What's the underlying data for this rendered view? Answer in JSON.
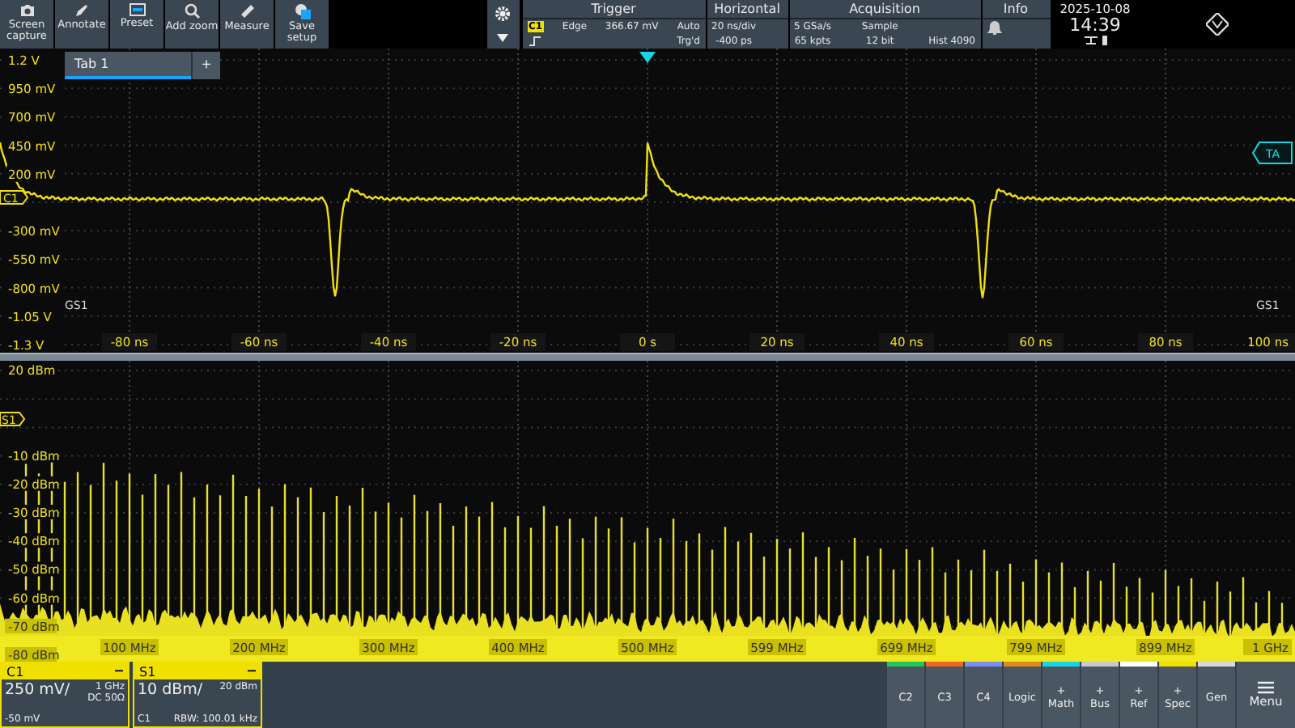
{
  "toolbar": {
    "buttons": [
      {
        "label": "Screen capture"
      },
      {
        "label": "Annotate"
      },
      {
        "label": "Preset"
      },
      {
        "label": "Add zoom"
      },
      {
        "label": "Measure"
      },
      {
        "label": "Save setup"
      }
    ]
  },
  "trigger": {
    "title": "Trigger",
    "source": "C1",
    "type": "Edge",
    "level": "366.67 mV",
    "mode": "Auto",
    "state": "Trg'd"
  },
  "horizontal": {
    "title": "Horizontal",
    "scale": "20 ns/div",
    "position": "-400 ps"
  },
  "acquisition": {
    "title": "Acquisition",
    "sample_rate": "5 GSa/s",
    "mode": "Sample",
    "points": "65 kpts",
    "resolution": "12 bit",
    "history": "Hist 4090"
  },
  "info": {
    "title": "Info"
  },
  "clock": {
    "date": "2025-10-08",
    "time": "14:39"
  },
  "tabs": [
    {
      "label": "Tab 1",
      "selected": true
    }
  ],
  "add_tab": "+",
  "time_plot": {
    "y_labels": [
      "1.2 V",
      "950 mV",
      "700 mV",
      "450 mV",
      "200 mV",
      "-300 mV",
      "-550 mV",
      "-800 mV",
      "-1.05 V",
      "-1.3 V"
    ],
    "x_labels": [
      "-80 ns",
      "-60 ns",
      "-40 ns",
      "-20 ns",
      "0 s",
      "20 ns",
      "40 ns",
      "60 ns",
      "80 ns",
      "100 ns"
    ],
    "channel_marker": "C1",
    "trigger_marker": "TA",
    "ground_markers": [
      "GS1",
      "GS1"
    ]
  },
  "spectrum_plot": {
    "y_labels": [
      "20 dBm",
      "-10 dBm",
      "-20 dBm",
      "-30 dBm",
      "-40 dBm",
      "-50 dBm",
      "-60 dBm",
      "-70 dBm",
      "-80 dBm"
    ],
    "x_labels": [
      "100 MHz",
      "200 MHz",
      "300 MHz",
      "400 MHz",
      "500 MHz",
      "599 MHz",
      "699 MHz",
      "799 MHz",
      "899 MHz",
      "1 GHz"
    ],
    "marker": "S1"
  },
  "channel_boxes": [
    {
      "name": "C1",
      "scale": "250 mV/",
      "line_1": "1 GHz",
      "line_2": "DC 50Ω",
      "footer_left": "-50 mV"
    },
    {
      "name": "S1",
      "scale": "10 dBm/",
      "line_2": "20 dBm",
      "footer_left": "C1",
      "footer_right": "RBW: 100.01 kHz"
    }
  ],
  "bottom_buttons": [
    {
      "label": "C2",
      "color": "#22c55e"
    },
    {
      "label": "C3",
      "color": "#f26522"
    },
    {
      "label": "C4",
      "color": "#7b8ff0"
    },
    {
      "label": "Logic",
      "color": "#e08a1e"
    },
    {
      "label": "Math",
      "prefix": "+",
      "color": "#19d4e6"
    },
    {
      "label": "Bus",
      "prefix": "+",
      "color": "#c8c8c8"
    },
    {
      "label": "Ref",
      "prefix": "+",
      "color": "#ffffff"
    },
    {
      "label": "Spec",
      "prefix": "+",
      "color": "#f0e000"
    },
    {
      "label": "Gen",
      "color": "#d8d8d8"
    }
  ],
  "menu": {
    "label": "Menu"
  }
}
